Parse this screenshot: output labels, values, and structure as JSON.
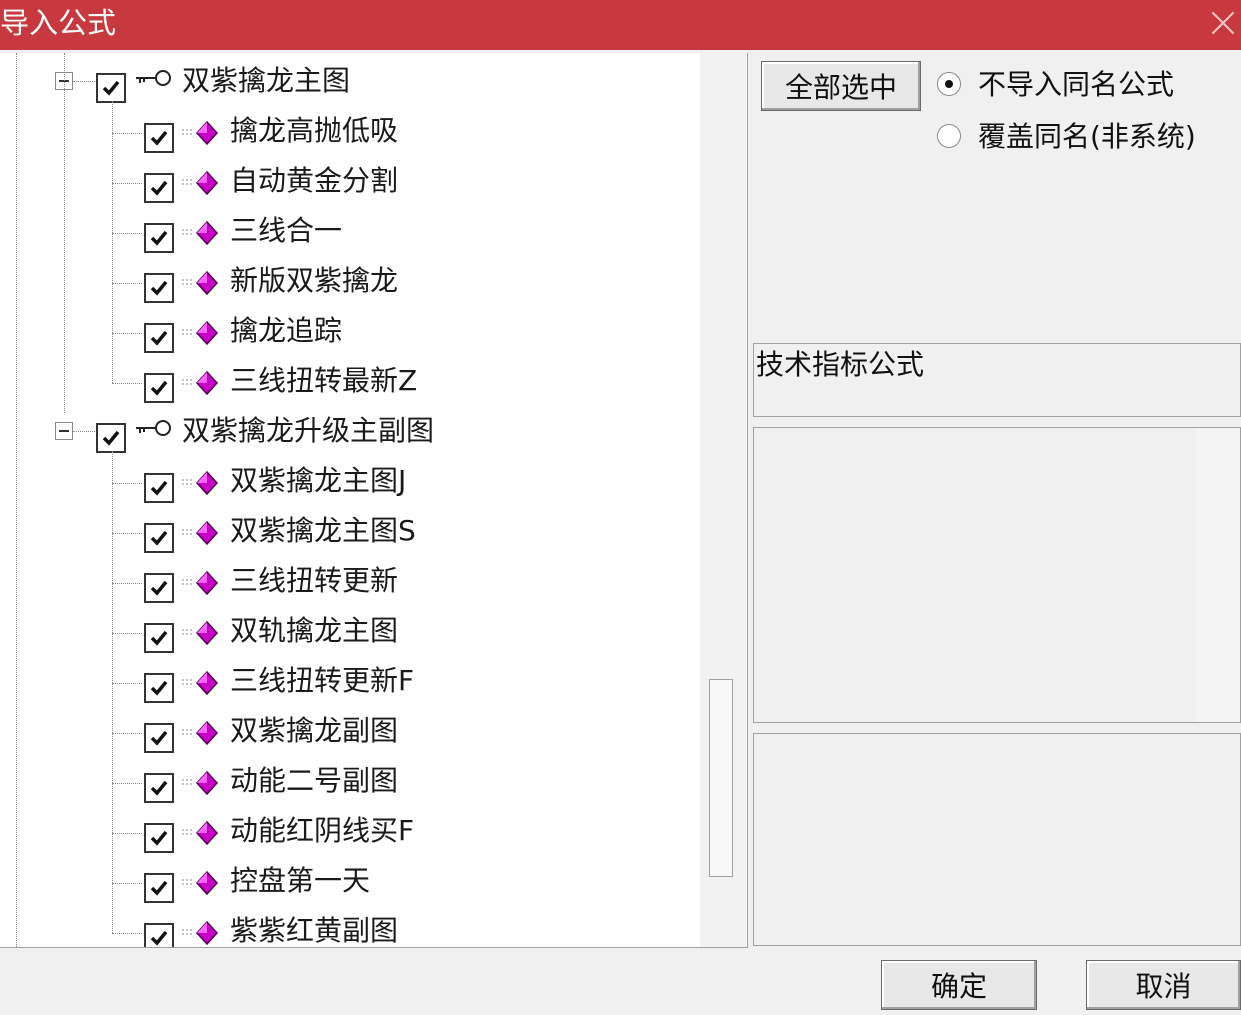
{
  "window": {
    "title": "导入公式",
    "close_icon": "close-icon"
  },
  "tree": {
    "groups": [
      {
        "label": "双紫擒龙主图",
        "checked": true,
        "icon": "key-icon",
        "children": [
          {
            "label": "擒龙高抛低吸",
            "checked": true,
            "icon": "gem-icon"
          },
          {
            "label": "自动黄金分割",
            "checked": true,
            "icon": "gem-icon"
          },
          {
            "label": "三线合一",
            "checked": true,
            "icon": "gem-icon"
          },
          {
            "label": "新版双紫擒龙",
            "checked": true,
            "icon": "gem-icon"
          },
          {
            "label": "擒龙追踪",
            "checked": true,
            "icon": "gem-icon"
          },
          {
            "label": "三线扭转最新Z",
            "checked": true,
            "icon": "gem-icon"
          }
        ]
      },
      {
        "label": "双紫擒龙升级主副图",
        "checked": true,
        "icon": "key-icon",
        "children": [
          {
            "label": "双紫擒龙主图J",
            "checked": true,
            "icon": "gem-icon"
          },
          {
            "label": "双紫擒龙主图S",
            "checked": true,
            "icon": "gem-icon"
          },
          {
            "label": "三线扭转更新",
            "checked": true,
            "icon": "gem-icon"
          },
          {
            "label": "双轨擒龙主图",
            "checked": true,
            "icon": "gem-icon"
          },
          {
            "label": "三线扭转更新F",
            "checked": true,
            "icon": "gem-icon"
          },
          {
            "label": "双紫擒龙副图",
            "checked": true,
            "icon": "gem-icon"
          },
          {
            "label": "动能二号副图",
            "checked": true,
            "icon": "gem-icon"
          },
          {
            "label": "动能红阴线买F",
            "checked": true,
            "icon": "gem-icon"
          },
          {
            "label": "控盘第一天",
            "checked": true,
            "icon": "gem-icon"
          },
          {
            "label": "紫紫红黄副图",
            "checked": true,
            "icon": "gem-icon"
          }
        ]
      }
    ]
  },
  "options": {
    "select_all_label": "全部选中",
    "radios": [
      {
        "label": "不导入同名公式",
        "checked": true
      },
      {
        "label": "覆盖同名(非系统)",
        "checked": false
      }
    ]
  },
  "info": {
    "category": "技术指标公式"
  },
  "footer": {
    "ok_label": "确定",
    "cancel_label": "取消"
  },
  "colors": {
    "title_bar": "#c8393f",
    "gem": "#c800c8",
    "background": "#f0f0f0"
  }
}
